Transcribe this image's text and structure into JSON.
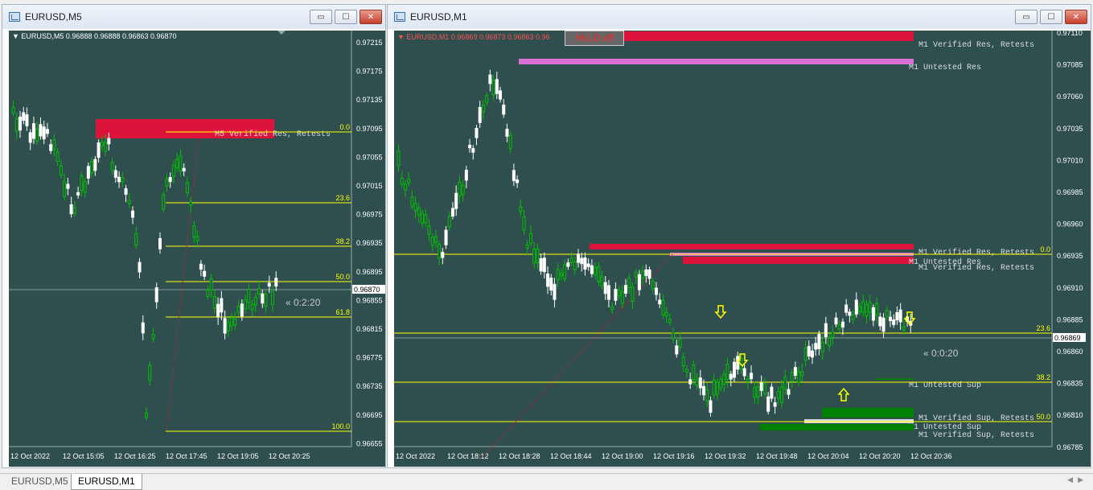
{
  "windows": {
    "m5": {
      "title": "EURUSD,M5",
      "buttons": {
        "minimize": "▭",
        "maximize": "☐",
        "close": "✕"
      },
      "chart": {
        "header": "EURUSD,M5  0.96888 0.96888 0.96863 0.96870",
        "price_levels": [
          "0.97215",
          "0.97175",
          "0.97135",
          "0.97095",
          "0.97055",
          "0.97015",
          "0.96975",
          "0.96935",
          "0.96895",
          "0.96855",
          "0.96815",
          "0.96775",
          "0.96735",
          "0.96695",
          "0.96655"
        ],
        "current_price": "0.96870",
        "time_labels": [
          "12 Oct 2022",
          "12 Oct 15:05",
          "12 Oct 16:25",
          "12 Oct 17:45",
          "12 Oct 19:05",
          "12 Oct 20:25"
        ],
        "fib_labels": [
          "0.0",
          "23.6",
          "38.2",
          "50.0",
          "61.8",
          "100.0"
        ],
        "zone_label": "M5 Verified Res, Retests",
        "countdown": "« 0:2:20"
      }
    },
    "m1": {
      "title": "EURUSD,M1",
      "buttons": {
        "minimize": "▭",
        "maximize": "☐",
        "close": "✕"
      },
      "chart": {
        "header": "EURUSD,M1  0.96869 0.96873 0.96863 0.96",
        "hilo_button": "Hi-LO off",
        "price_levels": [
          "0.97110",
          "0.97085",
          "0.97060",
          "0.97035",
          "0.97010",
          "0.96985",
          "0.96960",
          "0.96935",
          "0.96910",
          "0.96885",
          "0.96860",
          "0.96835",
          "0.96810",
          "0.96785"
        ],
        "current_price": "0.96869",
        "time_labels": [
          "12 Oct 2022",
          "12 Oct 18:12",
          "12 Oct 18:28",
          "12 Oct 18:44",
          "12 Oct 19:00",
          "12 Oct 19:16",
          "12 Oct 19:32",
          "12 Oct 19:48",
          "12 Oct 20:04",
          "12 Oct 20:20",
          "12 Oct 20:36"
        ],
        "fib_labels": [
          "0.0",
          "23.6",
          "38.2",
          "50.0"
        ],
        "zone_labels": {
          "verified_res_top": "M1 Verified Res, Retests",
          "untested_res_top": "M1 Untested Res",
          "verified_res_mid": "M1 Verified Res, Retests",
          "untested_res_mid": "M1 Untested Res",
          "verified_res_mid2": "M1 Verified Res, Retests",
          "untested_sup_1": "M1 Untested Sup",
          "verified_sup_1": "M1 Verified Sup, Retests",
          "untested_sup_2": "M1 Untested Sup",
          "verified_sup_2": "M1 Verified Sup, Retests"
        },
        "countdown": "« 0:0:20"
      }
    }
  },
  "tabs": [
    {
      "label": "EURUSD,M5",
      "active": false
    },
    {
      "label": "EURUSD,M1",
      "active": true
    }
  ],
  "colors": {
    "background": "#2f4f4f",
    "bull_candle": "#00c000",
    "bear_candle": "#ffffff",
    "resistance": "#dc143c",
    "untested_res": "#da70d6",
    "support": "#008000",
    "fib_line": "#ffff00",
    "arrow": "#ffff00"
  }
}
